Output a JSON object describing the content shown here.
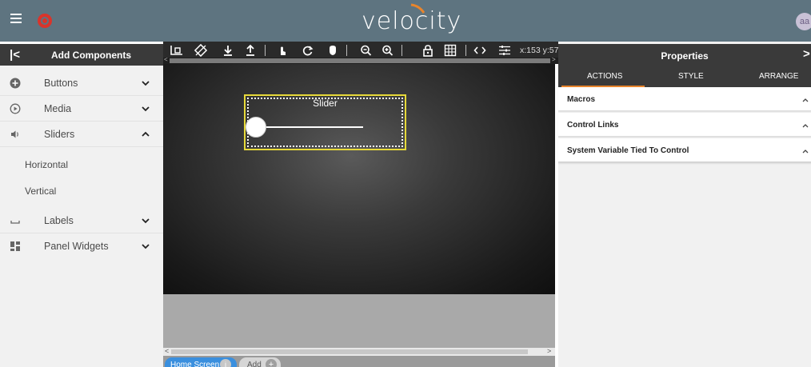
{
  "app": {
    "logo_text": "velocity",
    "user_initials": "aa"
  },
  "left_panel": {
    "collapse_glyph": "|<",
    "title": "Add Components",
    "categories": [
      {
        "label": "Buttons",
        "icon": "plus-circle-icon",
        "expanded": false
      },
      {
        "label": "Media",
        "icon": "play-circle-icon",
        "expanded": false
      },
      {
        "label": "Sliders",
        "icon": "speaker-icon",
        "expanded": true
      },
      {
        "label": "Labels",
        "icon": "label-bracket-icon",
        "expanded": false
      },
      {
        "label": "Panel Widgets",
        "icon": "widgets-grid-icon",
        "expanded": false
      }
    ],
    "slider_items": [
      "Horizontal",
      "Vertical"
    ]
  },
  "toolbar": {
    "coordinates": "x:153 y:57"
  },
  "canvas": {
    "component_label": "Slider",
    "selection_color": "#e7d93a"
  },
  "page_tabs": {
    "home": "Home Screen",
    "add": "Add"
  },
  "right_panel": {
    "title": "Properties",
    "close_glyph": ">",
    "tabs": [
      "ACTIONS",
      "STYLE",
      "ARRANGE"
    ],
    "active_tab": "ACTIONS",
    "accent": "#e8852c",
    "sections": [
      "Macros",
      "Control Links",
      "System Variable Tied To Control"
    ]
  },
  "colors": {
    "topbar": "#5e7480",
    "dark_header": "#3a3a3a",
    "brand_red": "#d9342b"
  }
}
